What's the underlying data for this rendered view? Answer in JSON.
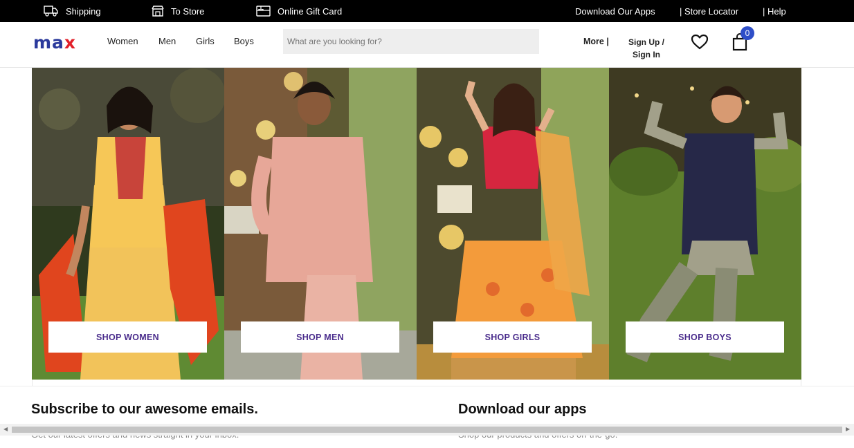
{
  "topbar": {
    "shipping": "Shipping",
    "to_store": "To Store",
    "gift_card": "Online Gift Card",
    "download_apps": "Download Our Apps",
    "store_locator": "| Store Locator",
    "help": "| Help"
  },
  "header": {
    "logo_ma": "ma",
    "logo_x": "x",
    "nav": [
      "Women",
      "Men",
      "Girls",
      "Boys"
    ],
    "search_placeholder": "What are you looking for?",
    "more": "More |",
    "sign_up": "Sign Up /",
    "sign_in": "Sign In",
    "cart_count": "0"
  },
  "hero": {
    "panels": [
      {
        "button": "SHOP WOMEN"
      },
      {
        "button": "SHOP MEN"
      },
      {
        "button": "SHOP GIRLS"
      },
      {
        "button": "SHOP BOYS"
      }
    ]
  },
  "footer": {
    "subscribe_title": "Subscribe to our awesome emails.",
    "subscribe_text": "Get our latest offers and news straight in your inbox.",
    "apps_title": "Download our apps",
    "apps_text": "Shop our products and offers on-the-go."
  },
  "colors": {
    "brand_blue": "#2b3a9c",
    "brand_red": "#e2202a",
    "button_text": "#4a2c8c",
    "badge": "#2e4ec8"
  }
}
